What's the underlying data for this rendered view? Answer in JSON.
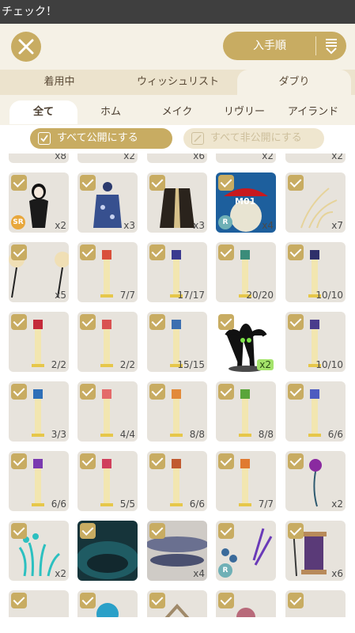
{
  "titlebar": {
    "title": "チェック！"
  },
  "header": {
    "sort_label": "入手順"
  },
  "tabs": [
    {
      "label": "着用中"
    },
    {
      "label": "ウィッシュリスト"
    },
    {
      "label": "ダブり"
    }
  ],
  "subtabs": [
    {
      "label": "全て"
    },
    {
      "label": "ホム"
    },
    {
      "label": "メイク"
    },
    {
      "label": "リヴリー"
    },
    {
      "label": "アイランド"
    }
  ],
  "publish": {
    "all_public": "すべて公開にする",
    "all_private": "すべて非公開にする"
  },
  "items": [
    {
      "count": "x8"
    },
    {
      "count": "x2"
    },
    {
      "count": "x6"
    },
    {
      "count": "x2"
    },
    {
      "count": "x2"
    },
    {
      "count": "x2",
      "badge": "SR"
    },
    {
      "count": "x3"
    },
    {
      "count": "x3"
    },
    {
      "count": "x4",
      "badge": "R",
      "label": "M01"
    },
    {
      "count": "x7"
    },
    {
      "count": "x5"
    },
    {
      "count": "7/7"
    },
    {
      "count": "17/17"
    },
    {
      "count": "20/20"
    },
    {
      "count": "10/10"
    },
    {
      "count": "2/2"
    },
    {
      "count": "2/2"
    },
    {
      "count": "15/15"
    },
    {
      "count": "x2"
    },
    {
      "count": "10/10"
    },
    {
      "count": "3/3"
    },
    {
      "count": "4/4"
    },
    {
      "count": "8/8"
    },
    {
      "count": "8/8"
    },
    {
      "count": "6/6"
    },
    {
      "count": "6/6"
    },
    {
      "count": "5/5"
    },
    {
      "count": "6/6"
    },
    {
      "count": "7/7"
    },
    {
      "count": "x2"
    },
    {
      "count": "x2"
    },
    {
      "count": ""
    },
    {
      "count": "x4"
    },
    {
      "count": "",
      "badge": "R"
    },
    {
      "count": "x6"
    },
    {
      "count": ""
    },
    {
      "count": ""
    },
    {
      "count": ""
    },
    {
      "count": ""
    },
    {
      "count": ""
    }
  ],
  "colors": {
    "accent": "#c8ac62",
    "background": "#f5f1e6",
    "tile": "#e7e3dc",
    "highlight": "#a4e36b"
  }
}
